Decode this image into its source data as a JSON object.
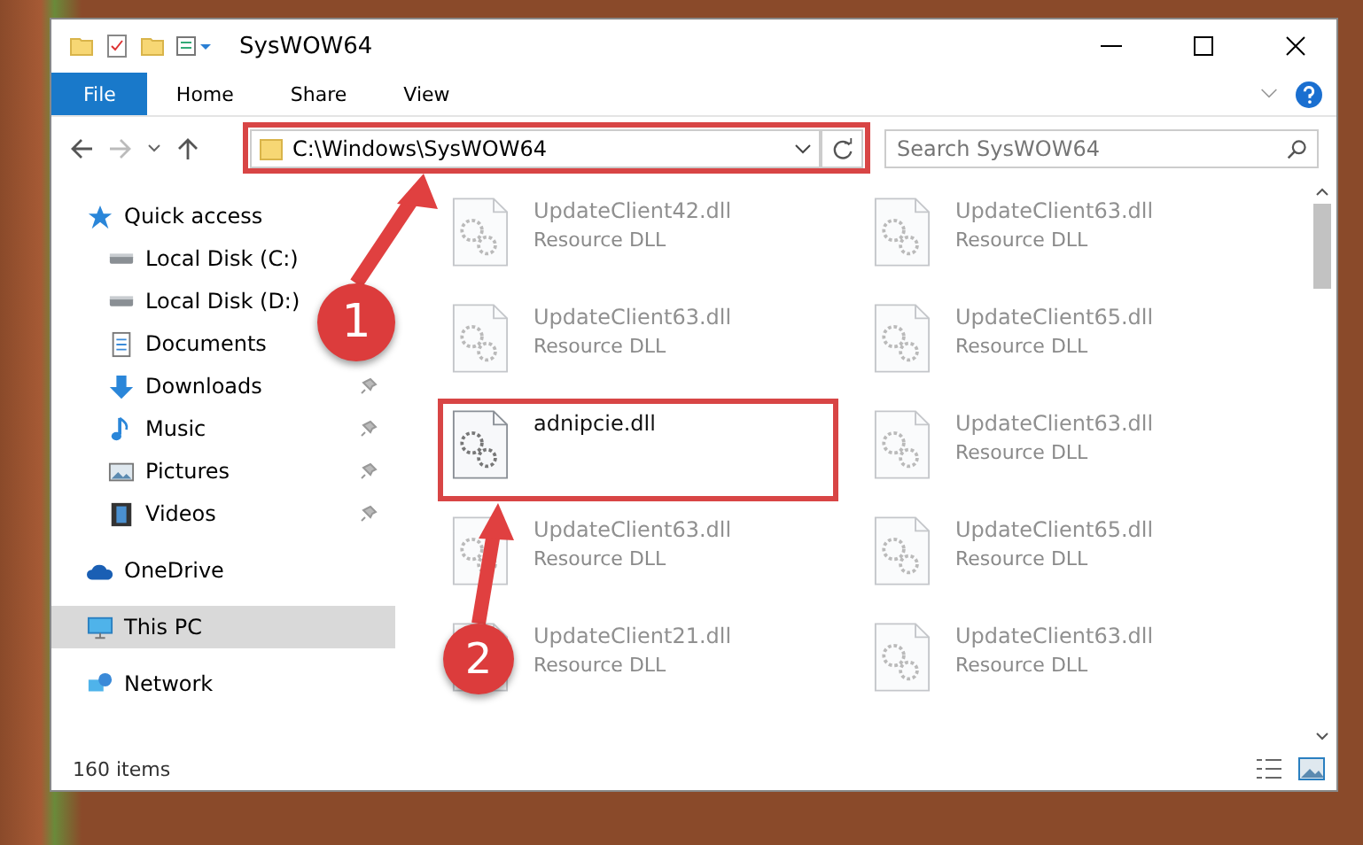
{
  "window": {
    "title": "SysWOW64"
  },
  "ribbon_tabs": [
    {
      "label": "File",
      "selected": true
    },
    {
      "label": "Home",
      "selected": false
    },
    {
      "label": "Share",
      "selected": false
    },
    {
      "label": "View",
      "selected": false
    }
  ],
  "address_bar": {
    "path": "C:\\Windows\\SysWOW64"
  },
  "search": {
    "placeholder": "Search SysWOW64"
  },
  "sidebar": {
    "items": [
      {
        "label": "Quick access",
        "kind": "star",
        "pinned": false,
        "selected": false,
        "children": [
          {
            "label": "Local Disk (C:)",
            "kind": "drive",
            "pinned": false,
            "selected": false
          },
          {
            "label": "Local Disk (D:)",
            "kind": "drive",
            "pinned": false,
            "selected": false
          },
          {
            "label": "Documents",
            "kind": "documents",
            "pinned": false,
            "selected": false
          },
          {
            "label": "Downloads",
            "kind": "downloads",
            "pinned": true,
            "selected": false
          },
          {
            "label": "Music",
            "kind": "music",
            "pinned": true,
            "selected": false
          },
          {
            "label": "Pictures",
            "kind": "pictures",
            "pinned": true,
            "selected": false
          },
          {
            "label": "Videos",
            "kind": "videos",
            "pinned": true,
            "selected": false
          }
        ]
      },
      {
        "label": "OneDrive",
        "kind": "cloud",
        "pinned": false,
        "selected": false
      },
      {
        "label": "This PC",
        "kind": "pc",
        "pinned": false,
        "selected": true
      },
      {
        "label": "Network",
        "kind": "network",
        "pinned": false,
        "selected": false
      }
    ]
  },
  "files": [
    {
      "name": "UpdateClient42.dll",
      "type": "Resource DLL",
      "dimmed": true
    },
    {
      "name": "UpdateClient63.dll",
      "type": "Resource DLL",
      "dimmed": true
    },
    {
      "name": "UpdateClient63.dll",
      "type": "Resource DLL",
      "dimmed": true
    },
    {
      "name": "UpdateClient65.dll",
      "type": "Resource DLL",
      "dimmed": true
    },
    {
      "name": "adnipcie.dll",
      "dimmed": false
    },
    {
      "name": "UpdateClient63.dll",
      "type": "Resource DLL",
      "dimmed": true
    },
    {
      "name": "UpdateClient63.dll",
      "type": "Resource DLL",
      "dimmed": true
    },
    {
      "name": "UpdateClient65.dll",
      "type": "Resource DLL",
      "dimmed": true
    },
    {
      "name": "UpdateClient21.dll",
      "type": "Resource DLL",
      "dimmed": true
    },
    {
      "name": "UpdateClient63.dll",
      "type": "Resource DLL",
      "dimmed": true
    }
  ],
  "status_bar": {
    "count": "160 items"
  },
  "annotations": [
    {
      "label": "1"
    },
    {
      "label": "2"
    }
  ]
}
